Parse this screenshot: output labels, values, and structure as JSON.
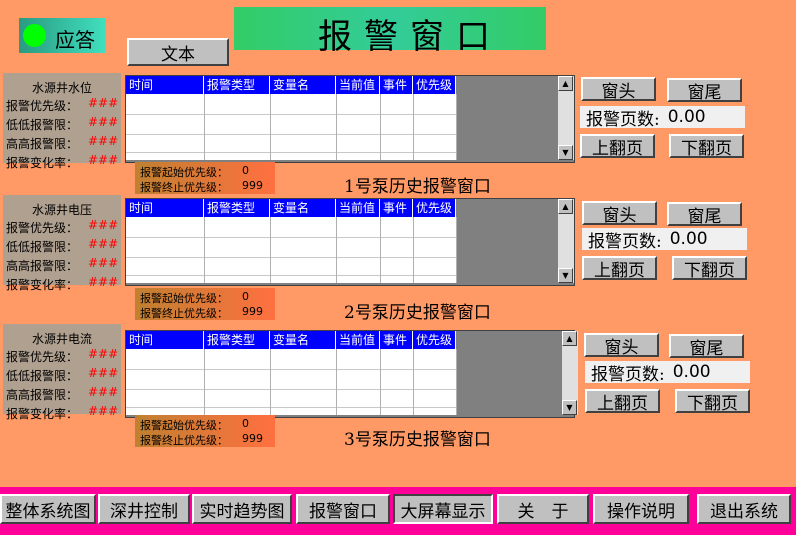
{
  "header": {
    "answer_label": "应答",
    "text_button": "文本",
    "title": "报警窗口"
  },
  "panels": [
    {
      "side_title": "水源井水位",
      "rows": [
        {
          "label": "报警优先级：",
          "value": "###"
        },
        {
          "label": "低低报警限：",
          "value": "###"
        },
        {
          "label": "高高报警限：",
          "value": "###"
        },
        {
          "label": "报警变化率：",
          "value": "###"
        }
      ],
      "columns": [
        "时间",
        "报警类型",
        "变量名",
        "当前值",
        "事件",
        "优先级"
      ],
      "range_start_label": "报警起始优先级：",
      "range_start_value": "0",
      "range_end_label": "报警终止优先级：",
      "range_end_value": "999",
      "history_title": "1号泵历史报警窗口",
      "head_button": "窗头",
      "tail_button": "窗尾",
      "page_label": "报警页数:",
      "page_value": "0.00",
      "prev_button": "上翻页",
      "next_button": "下翻页"
    },
    {
      "side_title": "水源井电压",
      "rows": [
        {
          "label": "报警优先级：",
          "value": "###"
        },
        {
          "label": "低低报警限：",
          "value": "###"
        },
        {
          "label": "高高报警限：",
          "value": "###"
        },
        {
          "label": "报警变化率：",
          "value": "###"
        }
      ],
      "columns": [
        "时间",
        "报警类型",
        "变量名",
        "当前值",
        "事件",
        "优先级"
      ],
      "range_start_label": "报警起始优先级：",
      "range_start_value": "0",
      "range_end_label": "报警终止优先级：",
      "range_end_value": "999",
      "history_title": "2号泵历史报警窗口",
      "head_button": "窗头",
      "tail_button": "窗尾",
      "page_label": "报警页数:",
      "page_value": "0.00",
      "prev_button": "上翻页",
      "next_button": "下翻页"
    },
    {
      "side_title": "水源井电流",
      "rows": [
        {
          "label": "报警优先级：",
          "value": "###"
        },
        {
          "label": "低低报警限：",
          "value": "###"
        },
        {
          "label": "高高报警限：",
          "value": "###"
        },
        {
          "label": "报警变化率：",
          "value": "###"
        }
      ],
      "columns": [
        "时间",
        "报警类型",
        "变量名",
        "当前值",
        "事件",
        "优先级"
      ],
      "range_start_label": "报警起始优先级：",
      "range_start_value": "0",
      "range_end_label": "报警终止优先级：",
      "range_end_value": "999",
      "history_title": "3号泵历史报警窗口",
      "head_button": "窗头",
      "tail_button": "窗尾",
      "page_label": "报警页数:",
      "page_value": "0.00",
      "prev_button": "上翻页",
      "next_button": "下翻页"
    }
  ],
  "nav": [
    "整体系统图",
    "深井控制",
    "实时趋势图",
    "报警窗口",
    "大屏幕显示",
    "关　于",
    "操作说明",
    "退出系统"
  ],
  "colors": {
    "background": "#ff9966",
    "title_bar": "#33cc66",
    "answer_box": "#33ccaa",
    "indicator": "#00ff00",
    "table_header": "#0000ff",
    "alarm_value": "#ff0000",
    "bottom_bar": "#ff0099"
  }
}
